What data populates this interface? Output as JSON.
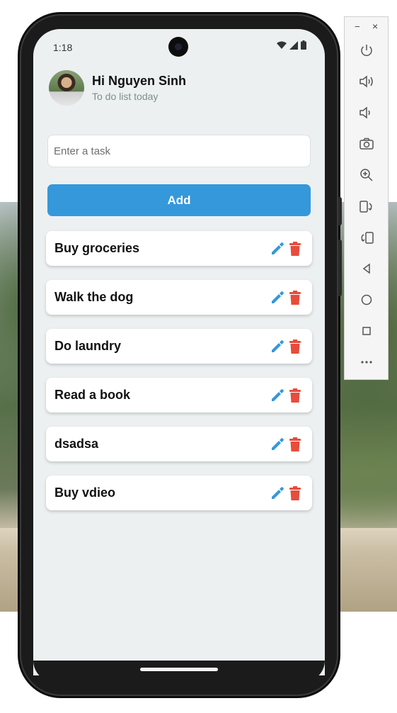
{
  "status_bar": {
    "time": "1:18"
  },
  "header": {
    "greeting": "Hi Nguyen Sinh",
    "subtitle": "To do list today"
  },
  "input": {
    "placeholder": "Enter a task",
    "value": ""
  },
  "add_button": {
    "label": "Add"
  },
  "tasks": [
    {
      "text": "Buy groceries"
    },
    {
      "text": "Walk the dog"
    },
    {
      "text": "Do laundry"
    },
    {
      "text": "Read a book"
    },
    {
      "text": "dsadsa"
    },
    {
      "text": "Buy vdieo"
    }
  ],
  "icons": {
    "edit": "pencil-icon",
    "delete": "trash-icon",
    "wifi": "wifi-icon",
    "signal": "signal-icon",
    "battery": "battery-icon"
  },
  "colors": {
    "accent": "#3498db",
    "delete": "#e74c3c",
    "edit": "#3498db",
    "background": "#ecf0f1"
  },
  "emulator_toolbar": {
    "minimize": "−",
    "close": "×",
    "buttons": [
      "power-icon",
      "volume-up-icon",
      "volume-down-icon",
      "camera-icon",
      "zoom-icon",
      "rotate-left-icon",
      "rotate-right-icon",
      "back-icon",
      "home-icon",
      "overview-icon",
      "more-icon"
    ]
  }
}
